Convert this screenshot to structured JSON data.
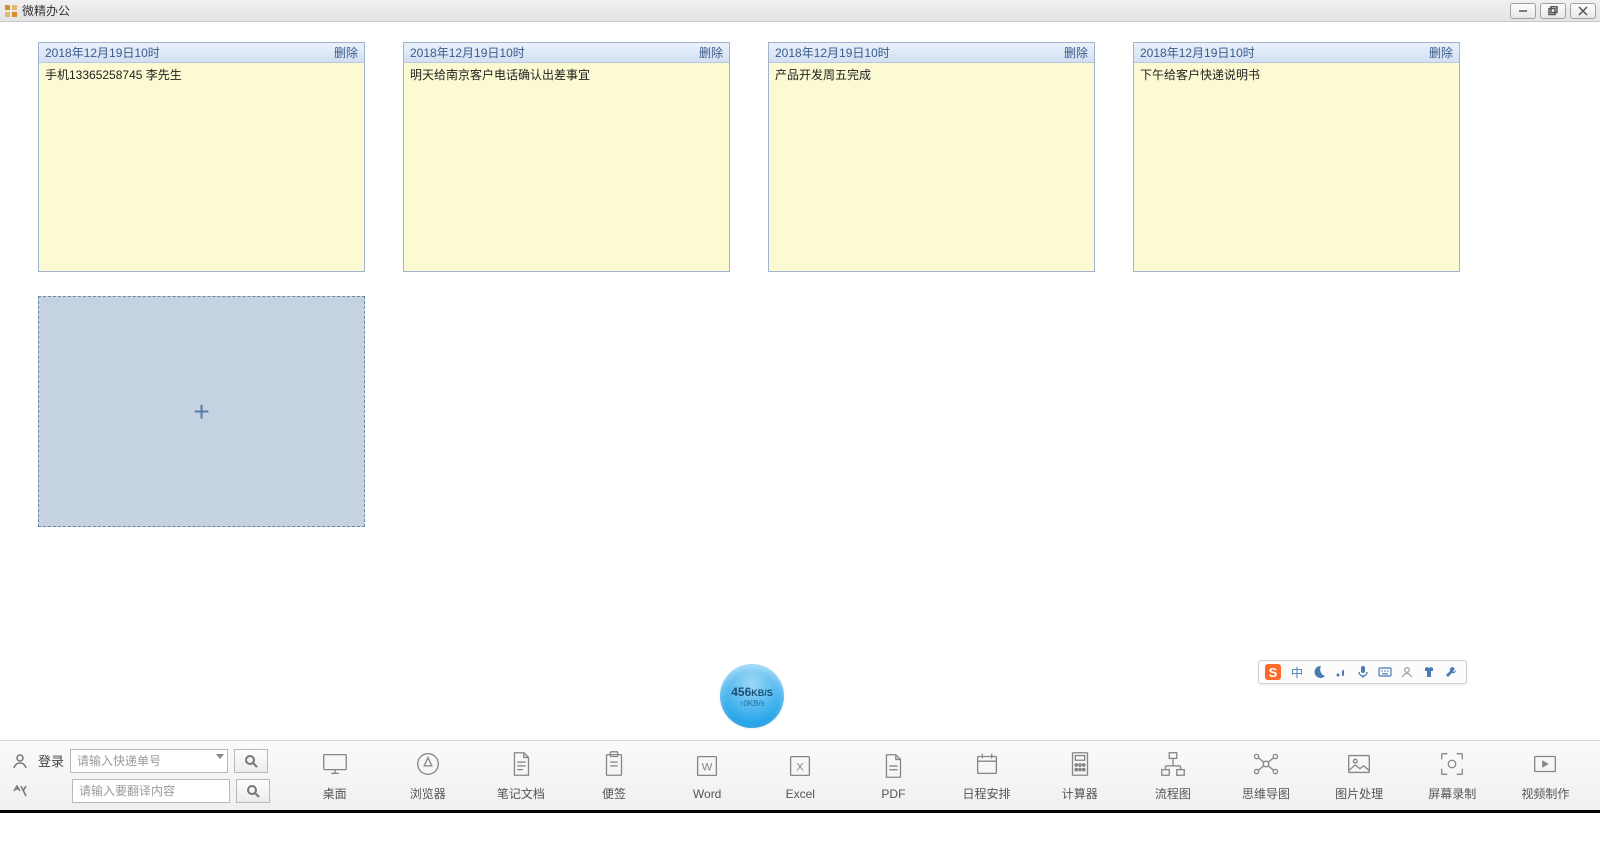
{
  "title": "微精办公",
  "notes": [
    {
      "date": "2018年12月19日10时",
      "delete_label": "删除",
      "text": "手机13365258745 李先生"
    },
    {
      "date": "2018年12月19日10时",
      "delete_label": "删除",
      "text": "明天给南京客户电话确认出差事宜"
    },
    {
      "date": "2018年12月19日10时",
      "delete_label": "删除",
      "text": "产品开发周五完成"
    },
    {
      "date": "2018年12月19日10时",
      "delete_label": "删除",
      "text": "下午给客户快递说明书"
    }
  ],
  "add_note_symbol": "+",
  "netspeed": {
    "down_value": "456",
    "down_unit": "KB/S",
    "up_text": "↑0KB/s"
  },
  "ime": {
    "lang": "中"
  },
  "bottom": {
    "login_label": "登录",
    "express_placeholder": "请输入快递单号",
    "translate_placeholder": "请输入要翻译内容",
    "tools": [
      {
        "key": "desktop",
        "label": "桌面"
      },
      {
        "key": "browser",
        "label": "浏览器"
      },
      {
        "key": "notes-doc",
        "label": "笔记文档"
      },
      {
        "key": "sticky",
        "label": "便签"
      },
      {
        "key": "word",
        "label": "Word"
      },
      {
        "key": "excel",
        "label": "Excel"
      },
      {
        "key": "pdf",
        "label": "PDF"
      },
      {
        "key": "calendar",
        "label": "日程安排"
      },
      {
        "key": "calculator",
        "label": "计算器"
      },
      {
        "key": "flowchart",
        "label": "流程图"
      },
      {
        "key": "mindmap",
        "label": "思维导图"
      },
      {
        "key": "image",
        "label": "图片处理"
      },
      {
        "key": "screenrec",
        "label": "屏幕录制"
      },
      {
        "key": "video",
        "label": "视频制作"
      }
    ]
  }
}
